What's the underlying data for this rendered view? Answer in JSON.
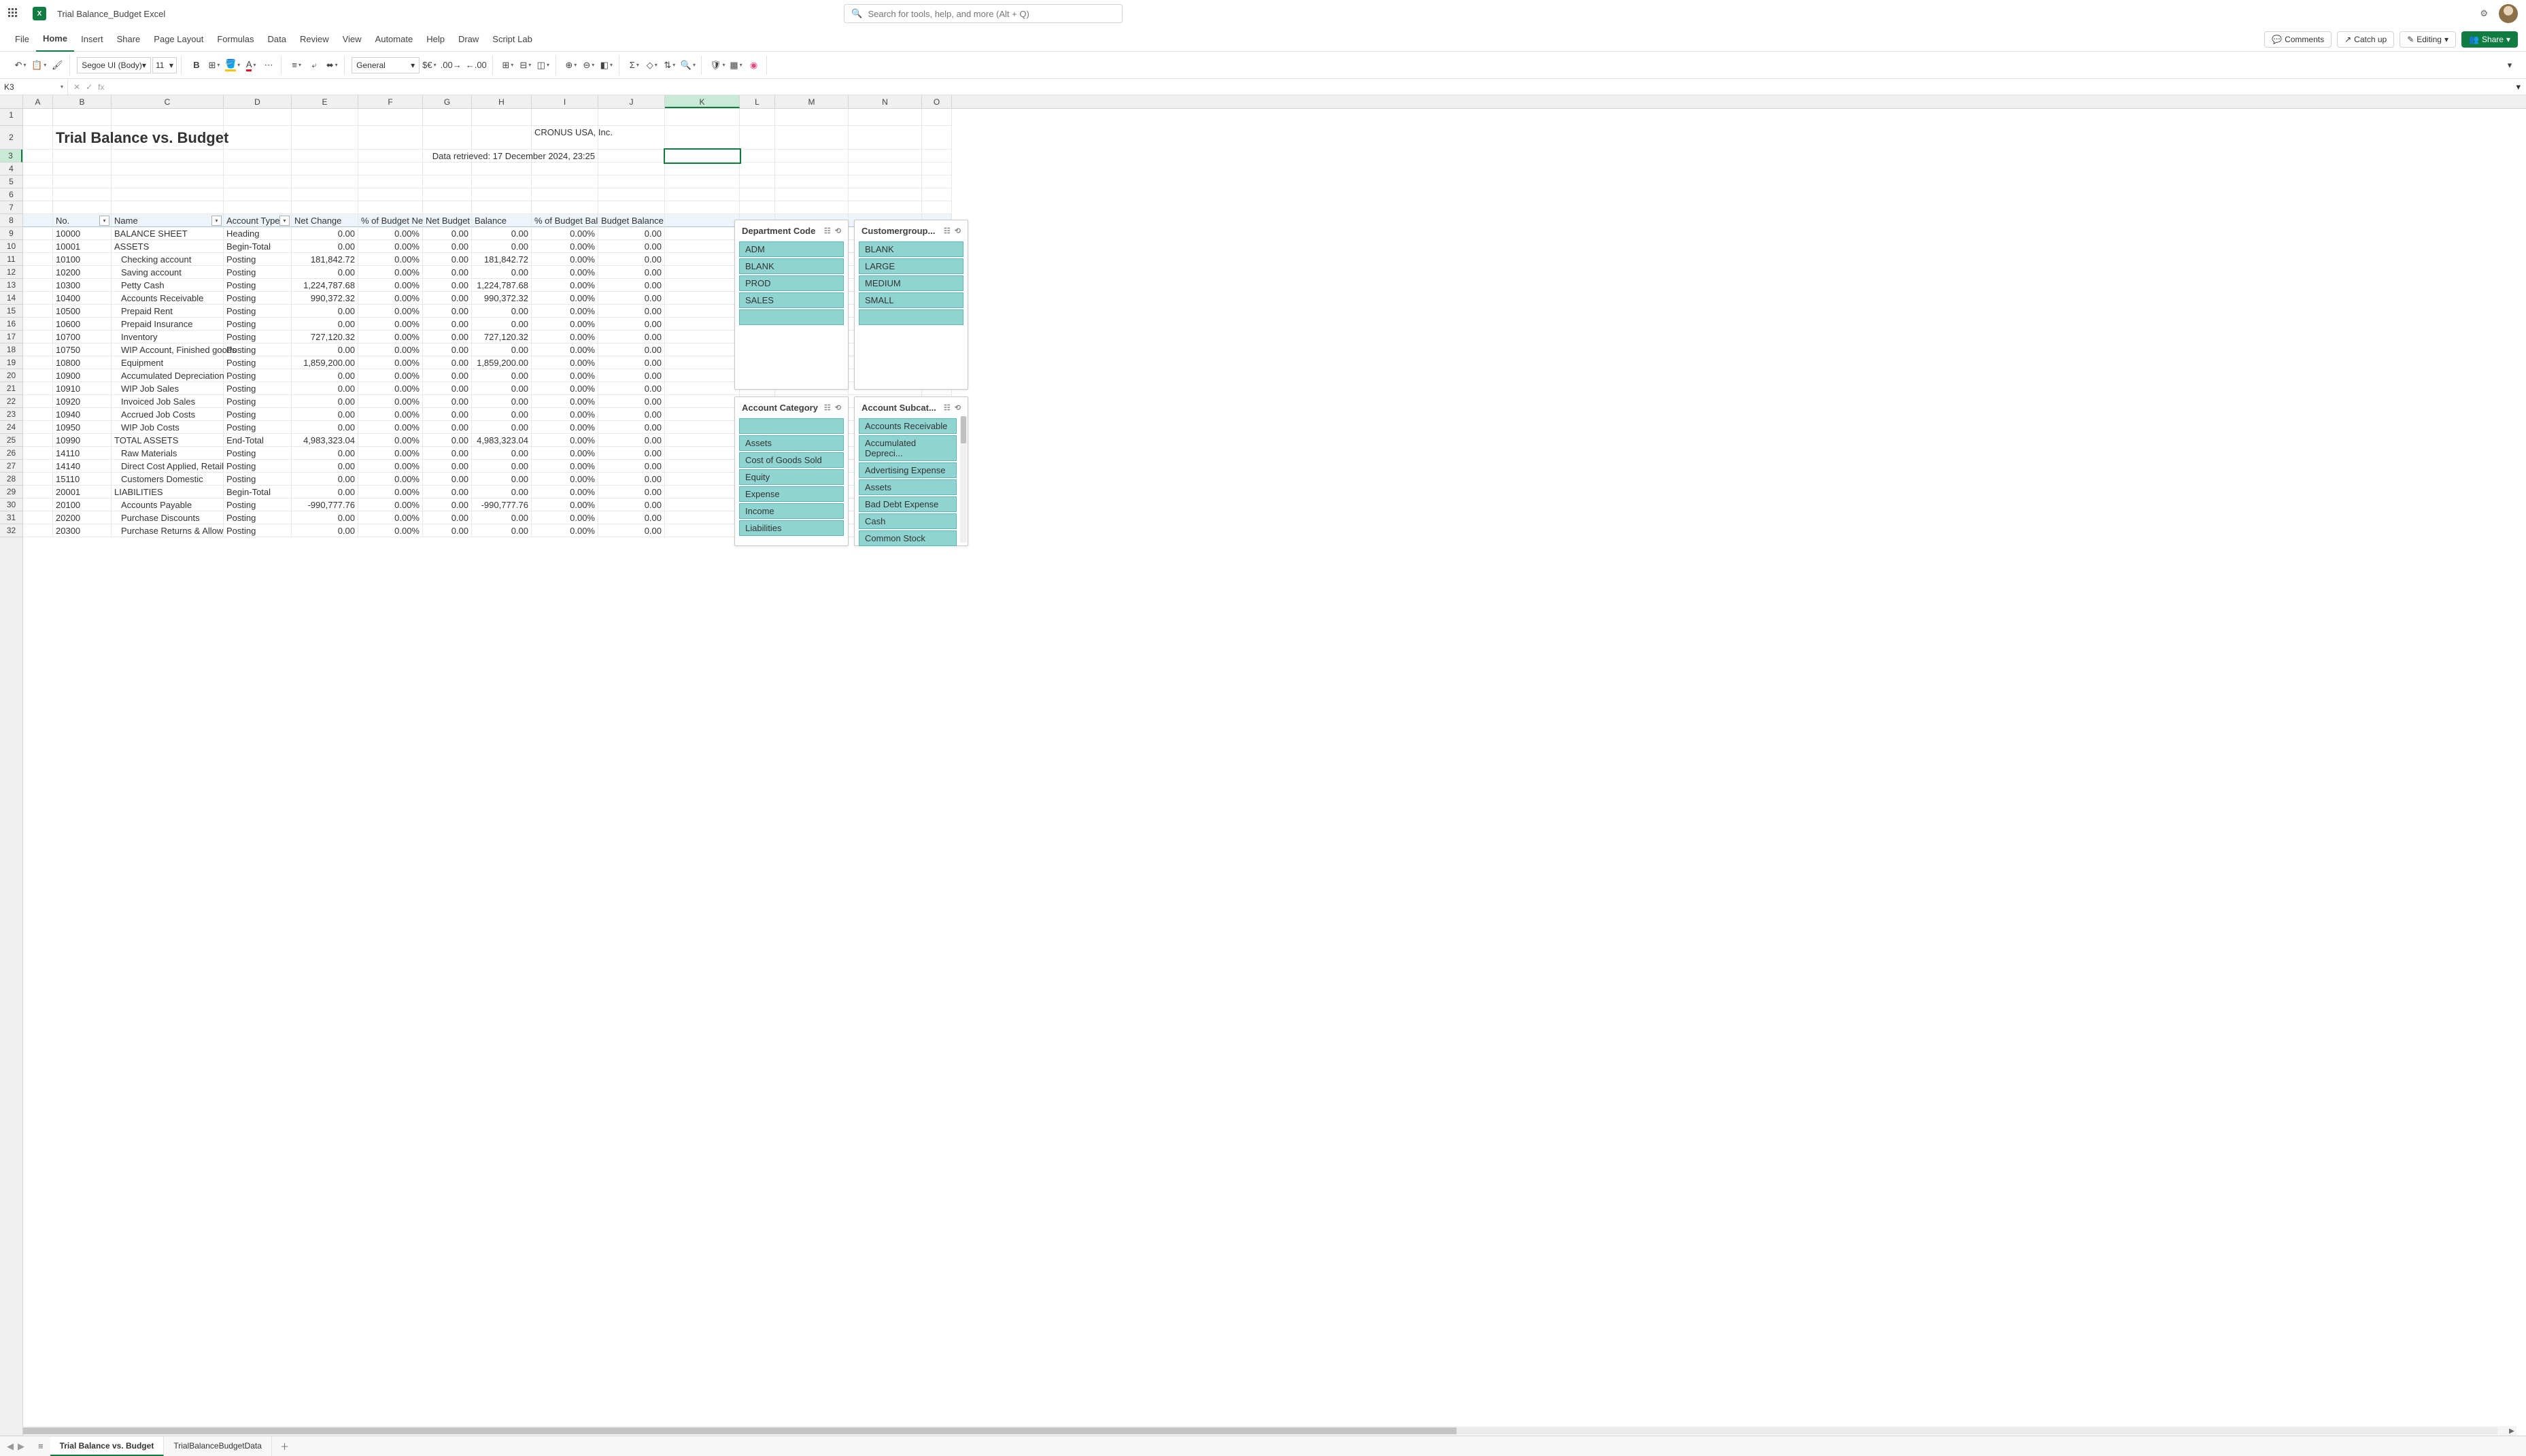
{
  "title_bar": {
    "app_abbrev": "X",
    "doc_title": "Trial Balance_Budget Excel",
    "search_placeholder": "Search for tools, help, and more (Alt + Q)"
  },
  "ribbon": {
    "tabs": [
      "File",
      "Home",
      "Insert",
      "Share",
      "Page Layout",
      "Formulas",
      "Data",
      "Review",
      "View",
      "Automate",
      "Help",
      "Draw",
      "Script Lab"
    ],
    "active_tab": "Home",
    "comments": "Comments",
    "catch_up": "Catch up",
    "editing": "Editing",
    "share": "Share"
  },
  "toolbar": {
    "font_name": "Segoe UI (Body)",
    "font_size": "11",
    "number_format": "General"
  },
  "formula_bar": {
    "name_box": "K3",
    "fx": "fx"
  },
  "columns": [
    "A",
    "B",
    "C",
    "D",
    "E",
    "F",
    "G",
    "H",
    "I",
    "J",
    "K",
    "L",
    "M",
    "N",
    "O"
  ],
  "selected_col": "K",
  "row_count": 32,
  "selected_row": 3,
  "report": {
    "title": "Trial Balance vs. Budget",
    "company": "CRONUS USA, Inc.",
    "retrieved": "Data retrieved: 17 December 2024, 23:25"
  },
  "table_headers": {
    "no": "No.",
    "name": "Name",
    "account_type": "Account Type",
    "net_change": "Net Change",
    "pct_budget_net": "% of Budget Net",
    "net_budget": "Net Budget",
    "balance": "Balance",
    "pct_budget_bal": "% of Budget Bal.",
    "budget_balance": "Budget Balance"
  },
  "rows": [
    {
      "no": "10000",
      "name": "BALANCE SHEET",
      "indent": 0,
      "type": "Heading",
      "nc": "0.00",
      "pbn": "0.00%",
      "nb": "0.00",
      "bal": "0.00",
      "pbb": "0.00%",
      "bb": "0.00"
    },
    {
      "no": "10001",
      "name": "ASSETS",
      "indent": 0,
      "type": "Begin-Total",
      "nc": "0.00",
      "pbn": "0.00%",
      "nb": "0.00",
      "bal": "0.00",
      "pbb": "0.00%",
      "bb": "0.00"
    },
    {
      "no": "10100",
      "name": "Checking account",
      "indent": 1,
      "type": "Posting",
      "nc": "181,842.72",
      "pbn": "0.00%",
      "nb": "0.00",
      "bal": "181,842.72",
      "pbb": "0.00%",
      "bb": "0.00"
    },
    {
      "no": "10200",
      "name": "Saving account",
      "indent": 1,
      "type": "Posting",
      "nc": "0.00",
      "pbn": "0.00%",
      "nb": "0.00",
      "bal": "0.00",
      "pbb": "0.00%",
      "bb": "0.00"
    },
    {
      "no": "10300",
      "name": "Petty Cash",
      "indent": 1,
      "type": "Posting",
      "nc": "1,224,787.68",
      "pbn": "0.00%",
      "nb": "0.00",
      "bal": "1,224,787.68",
      "pbb": "0.00%",
      "bb": "0.00"
    },
    {
      "no": "10400",
      "name": "Accounts Receivable",
      "indent": 1,
      "type": "Posting",
      "nc": "990,372.32",
      "pbn": "0.00%",
      "nb": "0.00",
      "bal": "990,372.32",
      "pbb": "0.00%",
      "bb": "0.00"
    },
    {
      "no": "10500",
      "name": "Prepaid Rent",
      "indent": 1,
      "type": "Posting",
      "nc": "0.00",
      "pbn": "0.00%",
      "nb": "0.00",
      "bal": "0.00",
      "pbb": "0.00%",
      "bb": "0.00"
    },
    {
      "no": "10600",
      "name": "Prepaid Insurance",
      "indent": 1,
      "type": "Posting",
      "nc": "0.00",
      "pbn": "0.00%",
      "nb": "0.00",
      "bal": "0.00",
      "pbb": "0.00%",
      "bb": "0.00"
    },
    {
      "no": "10700",
      "name": "Inventory",
      "indent": 1,
      "type": "Posting",
      "nc": "727,120.32",
      "pbn": "0.00%",
      "nb": "0.00",
      "bal": "727,120.32",
      "pbb": "0.00%",
      "bb": "0.00"
    },
    {
      "no": "10750",
      "name": "WIP Account, Finished goods",
      "indent": 1,
      "type": "Posting",
      "nc": "0.00",
      "pbn": "0.00%",
      "nb": "0.00",
      "bal": "0.00",
      "pbb": "0.00%",
      "bb": "0.00"
    },
    {
      "no": "10800",
      "name": "Equipment",
      "indent": 1,
      "type": "Posting",
      "nc": "1,859,200.00",
      "pbn": "0.00%",
      "nb": "0.00",
      "bal": "1,859,200.00",
      "pbb": "0.00%",
      "bb": "0.00"
    },
    {
      "no": "10900",
      "name": "Accumulated Depreciation",
      "indent": 1,
      "type": "Posting",
      "nc": "0.00",
      "pbn": "0.00%",
      "nb": "0.00",
      "bal": "0.00",
      "pbb": "0.00%",
      "bb": "0.00"
    },
    {
      "no": "10910",
      "name": "WIP Job Sales",
      "indent": 1,
      "type": "Posting",
      "nc": "0.00",
      "pbn": "0.00%",
      "nb": "0.00",
      "bal": "0.00",
      "pbb": "0.00%",
      "bb": "0.00"
    },
    {
      "no": "10920",
      "name": "Invoiced Job Sales",
      "indent": 1,
      "type": "Posting",
      "nc": "0.00",
      "pbn": "0.00%",
      "nb": "0.00",
      "bal": "0.00",
      "pbb": "0.00%",
      "bb": "0.00"
    },
    {
      "no": "10940",
      "name": "Accrued Job Costs",
      "indent": 1,
      "type": "Posting",
      "nc": "0.00",
      "pbn": "0.00%",
      "nb": "0.00",
      "bal": "0.00",
      "pbb": "0.00%",
      "bb": "0.00"
    },
    {
      "no": "10950",
      "name": "WIP Job Costs",
      "indent": 1,
      "type": "Posting",
      "nc": "0.00",
      "pbn": "0.00%",
      "nb": "0.00",
      "bal": "0.00",
      "pbb": "0.00%",
      "bb": "0.00"
    },
    {
      "no": "10990",
      "name": "TOTAL ASSETS",
      "indent": 0,
      "type": "End-Total",
      "nc": "4,983,323.04",
      "pbn": "0.00%",
      "nb": "0.00",
      "bal": "4,983,323.04",
      "pbb": "0.00%",
      "bb": "0.00"
    },
    {
      "no": "14110",
      "name": "Raw Materials",
      "indent": 1,
      "type": "Posting",
      "nc": "0.00",
      "pbn": "0.00%",
      "nb": "0.00",
      "bal": "0.00",
      "pbb": "0.00%",
      "bb": "0.00"
    },
    {
      "no": "14140",
      "name": "Direct Cost Applied, Retail",
      "indent": 1,
      "type": "Posting",
      "nc": "0.00",
      "pbn": "0.00%",
      "nb": "0.00",
      "bal": "0.00",
      "pbb": "0.00%",
      "bb": "0.00"
    },
    {
      "no": "15110",
      "name": "Customers Domestic",
      "indent": 1,
      "type": "Posting",
      "nc": "0.00",
      "pbn": "0.00%",
      "nb": "0.00",
      "bal": "0.00",
      "pbb": "0.00%",
      "bb": "0.00"
    },
    {
      "no": "20001",
      "name": "LIABILITIES",
      "indent": 0,
      "type": "Begin-Total",
      "nc": "0.00",
      "pbn": "0.00%",
      "nb": "0.00",
      "bal": "0.00",
      "pbb": "0.00%",
      "bb": "0.00"
    },
    {
      "no": "20100",
      "name": "Accounts Payable",
      "indent": 1,
      "type": "Posting",
      "nc": "-990,777.76",
      "pbn": "0.00%",
      "nb": "0.00",
      "bal": "-990,777.76",
      "pbb": "0.00%",
      "bb": "0.00"
    },
    {
      "no": "20200",
      "name": "Purchase Discounts",
      "indent": 1,
      "type": "Posting",
      "nc": "0.00",
      "pbn": "0.00%",
      "nb": "0.00",
      "bal": "0.00",
      "pbb": "0.00%",
      "bb": "0.00"
    },
    {
      "no": "20300",
      "name": "Purchase Returns & Allow",
      "indent": 1,
      "type": "Posting",
      "nc": "0.00",
      "pbn": "0.00%",
      "nb": "0.00",
      "bal": "0.00",
      "pbb": "0.00%",
      "bb": "0.00"
    }
  ],
  "slicers": {
    "dept": {
      "title": "Department Code",
      "items": [
        "ADM",
        "BLANK",
        "PROD",
        "SALES",
        ""
      ]
    },
    "custgrp": {
      "title": "Customergroup...",
      "items": [
        "BLANK",
        "LARGE",
        "MEDIUM",
        "SMALL",
        ""
      ]
    },
    "acct_cat": {
      "title": "Account Category",
      "items": [
        "",
        "Assets",
        "Cost of Goods Sold",
        "Equity",
        "Expense",
        "Income",
        "Liabilities"
      ]
    },
    "acct_sub": {
      "title": "Account Subcat...",
      "items": [
        "Accounts Receivable",
        "Accumulated Depreci...",
        "Advertising Expense",
        "Assets",
        "Bad Debt Expense",
        "Cash",
        "Common Stock"
      ]
    }
  },
  "sheets": {
    "tabs": [
      "Trial Balance vs. Budget",
      "TrialBalanceBudgetData"
    ],
    "active": 0
  }
}
